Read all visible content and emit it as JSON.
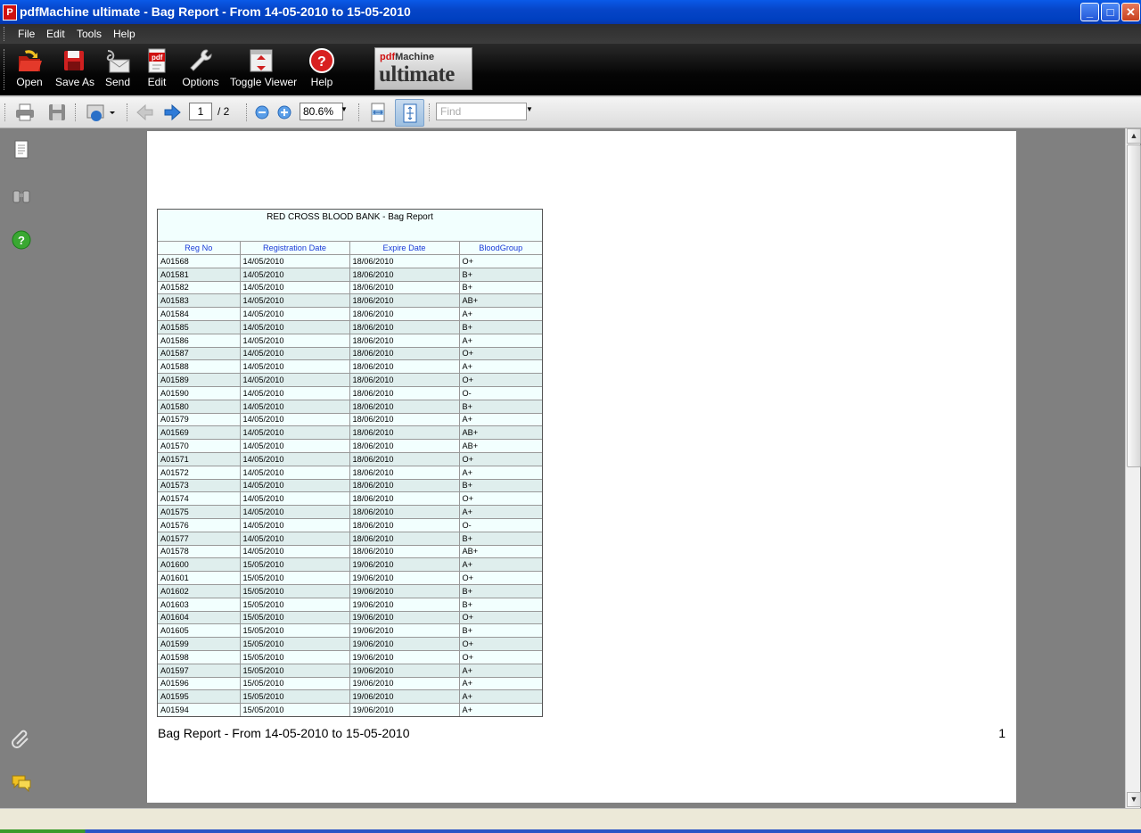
{
  "window": {
    "title": "pdfMachine ultimate - Bag Report  - From 14-05-2010 to 15-05-2010",
    "app_icon_letter": "P",
    "minimize": "_",
    "maximize": "□",
    "close": "✕"
  },
  "menu": [
    "File",
    "Edit",
    "Tools",
    "Help"
  ],
  "toolbar": {
    "open": "Open",
    "save_as": "Save As",
    "send": "Send",
    "edit": "Edit",
    "options": "Options",
    "toggle_viewer": "Toggle Viewer",
    "help": "Help",
    "logo_pdf": "pdf",
    "logo_machine": "Machine",
    "logo_ultimate": "ultimate"
  },
  "viewer": {
    "current_page": "1",
    "total_pages": "/ 2",
    "zoom": "80.6%",
    "find_placeholder": "Find"
  },
  "report": {
    "title": "RED CROSS BLOOD BANK - Bag Report",
    "columns": [
      "Reg No",
      "Registration Date",
      "Expire Date",
      "BloodGroup"
    ],
    "rows": [
      [
        "A01568",
        "14/05/2010",
        "18/06/2010",
        "O+"
      ],
      [
        "A01581",
        "14/05/2010",
        "18/06/2010",
        "B+"
      ],
      [
        "A01582",
        "14/05/2010",
        "18/06/2010",
        "B+"
      ],
      [
        "A01583",
        "14/05/2010",
        "18/06/2010",
        "AB+"
      ],
      [
        "A01584",
        "14/05/2010",
        "18/06/2010",
        "A+"
      ],
      [
        "A01585",
        "14/05/2010",
        "18/06/2010",
        "B+"
      ],
      [
        "A01586",
        "14/05/2010",
        "18/06/2010",
        "A+"
      ],
      [
        "A01587",
        "14/05/2010",
        "18/06/2010",
        "O+"
      ],
      [
        "A01588",
        "14/05/2010",
        "18/06/2010",
        "A+"
      ],
      [
        "A01589",
        "14/05/2010",
        "18/06/2010",
        "O+"
      ],
      [
        "A01590",
        "14/05/2010",
        "18/06/2010",
        "O-"
      ],
      [
        "A01580",
        "14/05/2010",
        "18/06/2010",
        "B+"
      ],
      [
        "A01579",
        "14/05/2010",
        "18/06/2010",
        "A+"
      ],
      [
        "A01569",
        "14/05/2010",
        "18/06/2010",
        "AB+"
      ],
      [
        "A01570",
        "14/05/2010",
        "18/06/2010",
        "AB+"
      ],
      [
        "A01571",
        "14/05/2010",
        "18/06/2010",
        "O+"
      ],
      [
        "A01572",
        "14/05/2010",
        "18/06/2010",
        "A+"
      ],
      [
        "A01573",
        "14/05/2010",
        "18/06/2010",
        "B+"
      ],
      [
        "A01574",
        "14/05/2010",
        "18/06/2010",
        "O+"
      ],
      [
        "A01575",
        "14/05/2010",
        "18/06/2010",
        "A+"
      ],
      [
        "A01576",
        "14/05/2010",
        "18/06/2010",
        "O-"
      ],
      [
        "A01577",
        "14/05/2010",
        "18/06/2010",
        "B+"
      ],
      [
        "A01578",
        "14/05/2010",
        "18/06/2010",
        "AB+"
      ],
      [
        "A01600",
        "15/05/2010",
        "19/06/2010",
        "A+"
      ],
      [
        "A01601",
        "15/05/2010",
        "19/06/2010",
        "O+"
      ],
      [
        "A01602",
        "15/05/2010",
        "19/06/2010",
        "B+"
      ],
      [
        "A01603",
        "15/05/2010",
        "19/06/2010",
        "B+"
      ],
      [
        "A01604",
        "15/05/2010",
        "19/06/2010",
        "O+"
      ],
      [
        "A01605",
        "15/05/2010",
        "19/06/2010",
        "B+"
      ],
      [
        "A01599",
        "15/05/2010",
        "19/06/2010",
        "O+"
      ],
      [
        "A01598",
        "15/05/2010",
        "19/06/2010",
        "O+"
      ],
      [
        "A01597",
        "15/05/2010",
        "19/06/2010",
        "A+"
      ],
      [
        "A01596",
        "15/05/2010",
        "19/06/2010",
        "A+"
      ],
      [
        "A01595",
        "15/05/2010",
        "19/06/2010",
        "A+"
      ],
      [
        "A01594",
        "15/05/2010",
        "19/06/2010",
        "A+"
      ]
    ],
    "footer": "Bag Report  - From 14-05-2010 to 15-05-2010",
    "page_number": "1"
  },
  "icons": [
    "pages-icon",
    "binoculars-icon",
    "help-circle-icon",
    "paperclip-icon",
    "comments-icon"
  ],
  "colors": {
    "titlebar": "#0645c8",
    "report_header_text": "#1a3ad8",
    "row_light": "#f2fffe",
    "row_dark": "#dfeeed"
  }
}
